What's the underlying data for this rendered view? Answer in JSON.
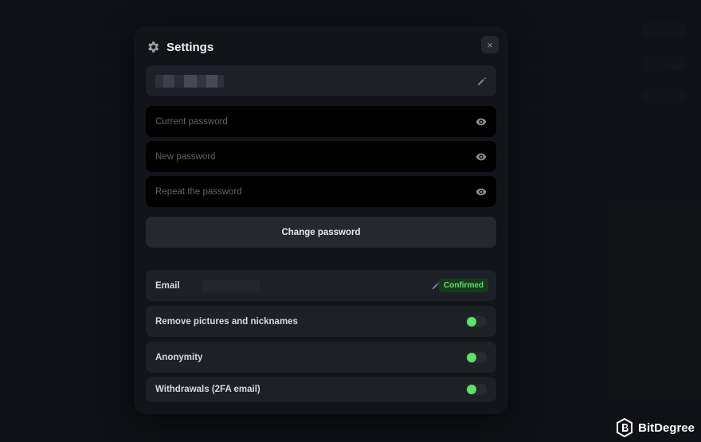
{
  "dialog": {
    "title": "Settings",
    "close_label": "×"
  },
  "password_form": {
    "current_placeholder": "Current password",
    "new_placeholder": "New password",
    "repeat_placeholder": "Repeat the password",
    "change_button": "Change password"
  },
  "email": {
    "label": "Email",
    "status": "Confirmed"
  },
  "toggles": [
    {
      "label": "Remove pictures and nicknames",
      "enabled": true
    },
    {
      "label": "Anonymity",
      "enabled": true
    },
    {
      "label": "Withdrawals (2FA email)",
      "enabled": true
    }
  ],
  "watermark": {
    "text": "BitDegree"
  },
  "colors": {
    "accent_green": "#5fe06a",
    "modal_bg": "#121419",
    "input_bg": "#000000"
  }
}
